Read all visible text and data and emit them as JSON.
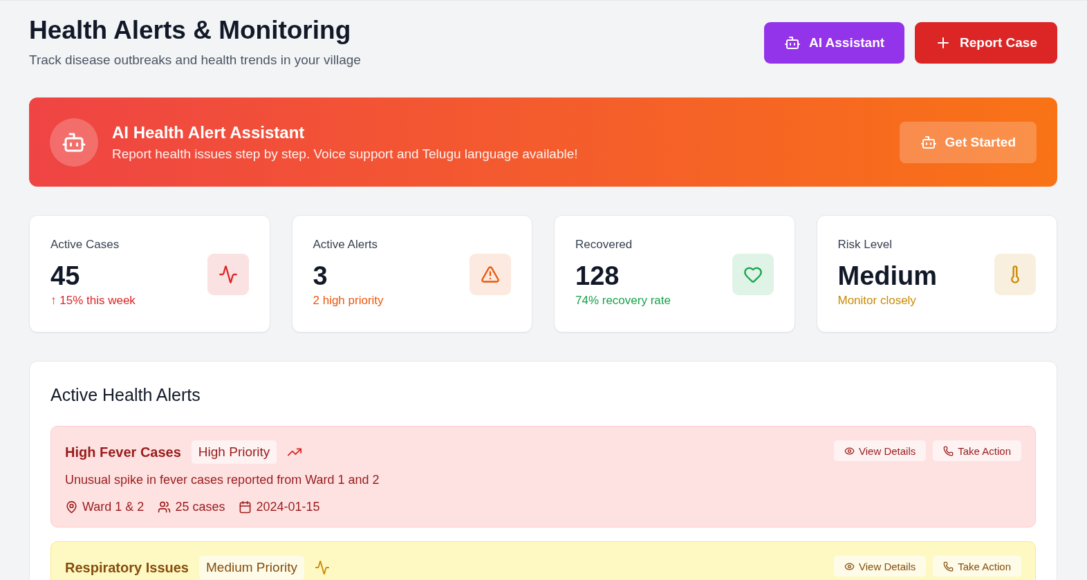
{
  "header": {
    "title": "Health Alerts & Monitoring",
    "subtitle": "Track disease outbreaks and health trends in your village",
    "buttons": [
      {
        "label": "AI Assistant",
        "kind": "assistant"
      },
      {
        "label": "Report Case",
        "kind": "report"
      }
    ]
  },
  "banner": {
    "title": "AI Health Alert Assistant",
    "text": "Report health issues step by step. Voice support and Telugu language available!",
    "button": "Get Started"
  },
  "stats": [
    {
      "label": "Active Cases",
      "value": "45",
      "note": "↑ 15% this week",
      "kind": "activity",
      "color": "#dc2626"
    },
    {
      "label": "Active Alerts",
      "value": "3",
      "note": "2 high priority",
      "kind": "alert",
      "color": "#ea580c"
    },
    {
      "label": "Recovered",
      "value": "128",
      "note": "74% recovery rate",
      "kind": "heart",
      "color": "#16a34a"
    },
    {
      "label": "Risk Level",
      "value": "Medium",
      "note": "Monitor closely",
      "kind": "thermometer",
      "color": "#ca8a04"
    }
  ],
  "alerts_panel": {
    "title": "Active Health Alerts",
    "alerts": [
      {
        "title": "High Fever Cases",
        "kind": "high",
        "badge": "High Priority",
        "trend_icon": {
          "kind": "rising"
        },
        "description": "Unusual spike in fever cases reported from Ward 1 and 2",
        "location": "Ward 1 & 2",
        "cases": "25 cases",
        "date": "2024-01-15",
        "actions": [
          "View Details",
          "Take Action"
        ]
      },
      {
        "title": "Respiratory Issues",
        "kind": "medium",
        "badge": "Medium Priority",
        "trend_icon": {
          "kind": "steady"
        },
        "actions": [
          "View Details",
          "Take Action"
        ]
      }
    ]
  }
}
